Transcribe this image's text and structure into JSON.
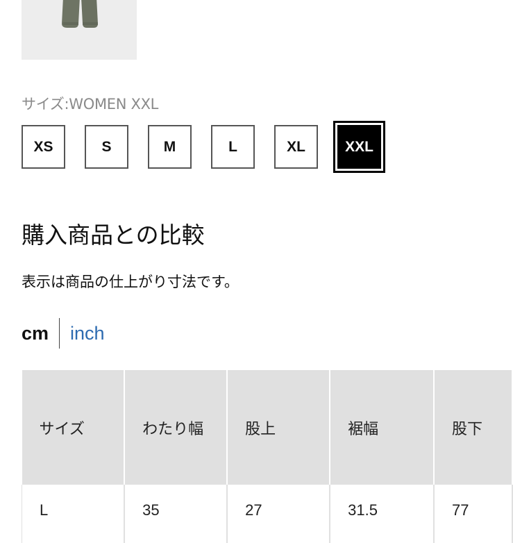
{
  "product": {
    "thumbnail_icon": "pants-thumbnail-image"
  },
  "size_selector": {
    "caption": "サイズ:WOMEN XXL",
    "options": [
      "XS",
      "S",
      "M",
      "L",
      "XL",
      "XXL"
    ],
    "selected": "XXL"
  },
  "comparison": {
    "title": "購入商品との比較",
    "note": "表示は商品の仕上がり寸法です。"
  },
  "units": {
    "cm": "cm",
    "inch": "inch",
    "active": "cm",
    "link_color": "#2d6bb0"
  },
  "size_table": {
    "headers": [
      "サイズ",
      "わたり幅",
      "股上",
      "裾幅",
      "股下"
    ],
    "rows": [
      [
        "L",
        "35",
        "27",
        "31.5",
        "77"
      ]
    ]
  },
  "colors": {
    "selected_bg": "#000000",
    "header_bg": "#e0e0e0",
    "caption_gray": "#8a8a8a"
  }
}
